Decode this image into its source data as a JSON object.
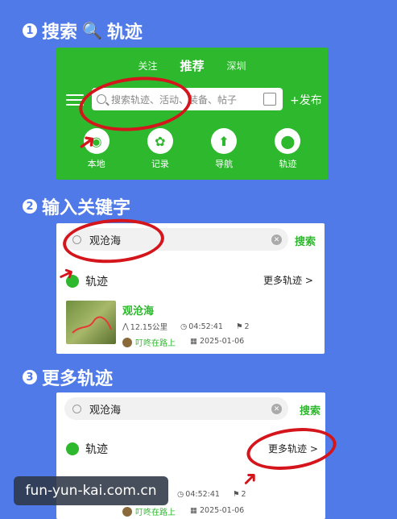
{
  "steps": [
    {
      "num": "1",
      "title_a": "搜索",
      "title_b": "轨迹"
    },
    {
      "num": "2",
      "title": "输入关键字"
    },
    {
      "num": "3",
      "title": "更多轨迹"
    }
  ],
  "app": {
    "tabs": [
      "关注",
      "推荐",
      "深圳"
    ],
    "search_placeholder": "搜索轨迹、活动、装备、帖子",
    "publish_label": "+发布",
    "nav": [
      {
        "label": "本地",
        "icon": "location-icon"
      },
      {
        "label": "记录",
        "icon": "footprint-icon"
      },
      {
        "label": "导航",
        "icon": "arrow-up-icon"
      },
      {
        "label": "轨迹",
        "icon": "map-pin-icon"
      }
    ]
  },
  "search": {
    "query": "观沧海",
    "button": "搜索",
    "section": "轨迹",
    "more": "更多轨迹 >"
  },
  "result": {
    "title": "观沧海",
    "distance": "12.15公里",
    "duration": "04:52:41",
    "count": "2",
    "user": "叮咚在路上",
    "date": "2025-01-06"
  },
  "watermark": "fun-yun-kai.com.cn",
  "colors": {
    "background": "#4f7ae8",
    "green": "#2eb82e",
    "circle_red": "#d4151b"
  }
}
